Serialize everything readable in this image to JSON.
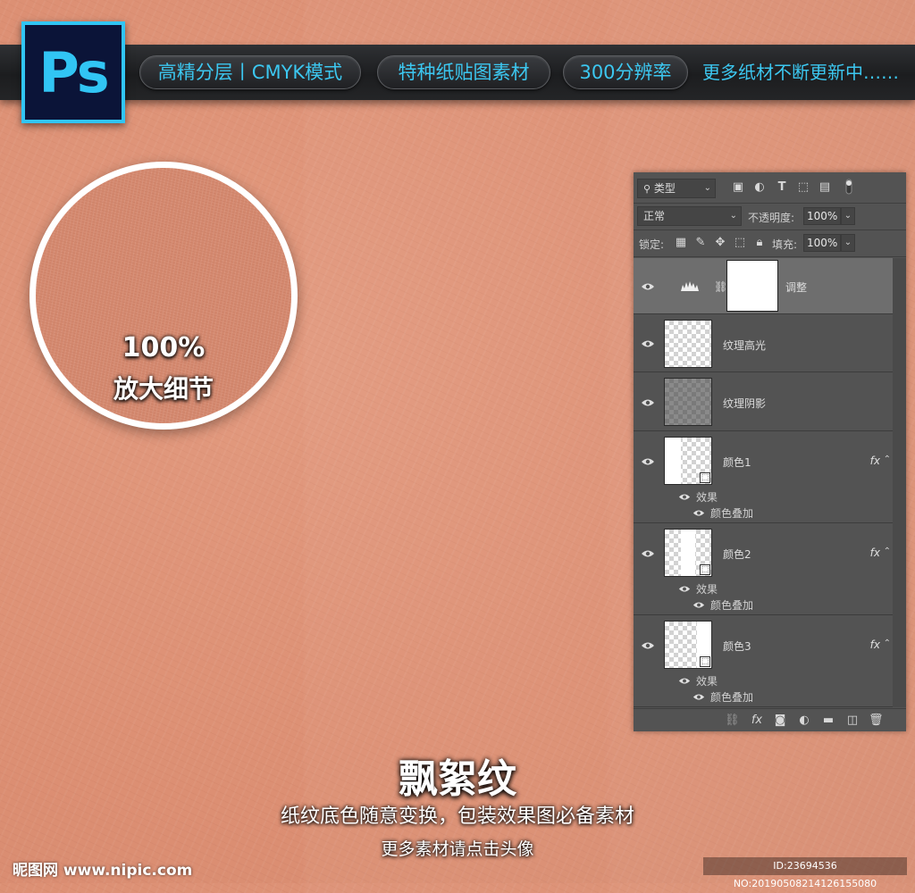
{
  "banner": {
    "logo_text": "Ps",
    "pills": [
      "高精分层丨CMYK模式",
      "特种纸贴图素材",
      "300分辨率"
    ],
    "more_text": "更多纸材不断更新中……"
  },
  "zoom": {
    "percent": "100%",
    "label": "放大细节"
  },
  "layers_panel": {
    "filter_type": "类型",
    "blend_mode": "正常",
    "opacity_label": "不透明度:",
    "opacity_value": "100%",
    "lock_label": "锁定:",
    "fill_label": "填充:",
    "fill_value": "100%",
    "layers": [
      {
        "name": "调整",
        "kind": "adjustment"
      },
      {
        "name": "纹理高光",
        "kind": "transparent"
      },
      {
        "name": "纹理阴影",
        "kind": "dark"
      },
      {
        "name": "颜色1",
        "kind": "color",
        "fx": "fx",
        "effects_label": "效果",
        "effect": "颜色叠加"
      },
      {
        "name": "颜色2",
        "kind": "color",
        "fx": "fx",
        "effects_label": "效果",
        "effect": "颜色叠加"
      },
      {
        "name": "颜色3",
        "kind": "color",
        "fx": "fx",
        "effects_label": "效果",
        "effect": "颜色叠加"
      }
    ]
  },
  "footer": {
    "title": "飘絮纹",
    "subtitle": "纸纹底色随意变换，包装效果图必备素材",
    "cta": "更多素材请点击头像",
    "watermark_left": "昵图网 www.nipic.com",
    "watermark_right": "ID:23694536 NO:20190508214126155080"
  },
  "colors": {
    "accent": "#31c5f4",
    "background": "#dc8f73"
  }
}
